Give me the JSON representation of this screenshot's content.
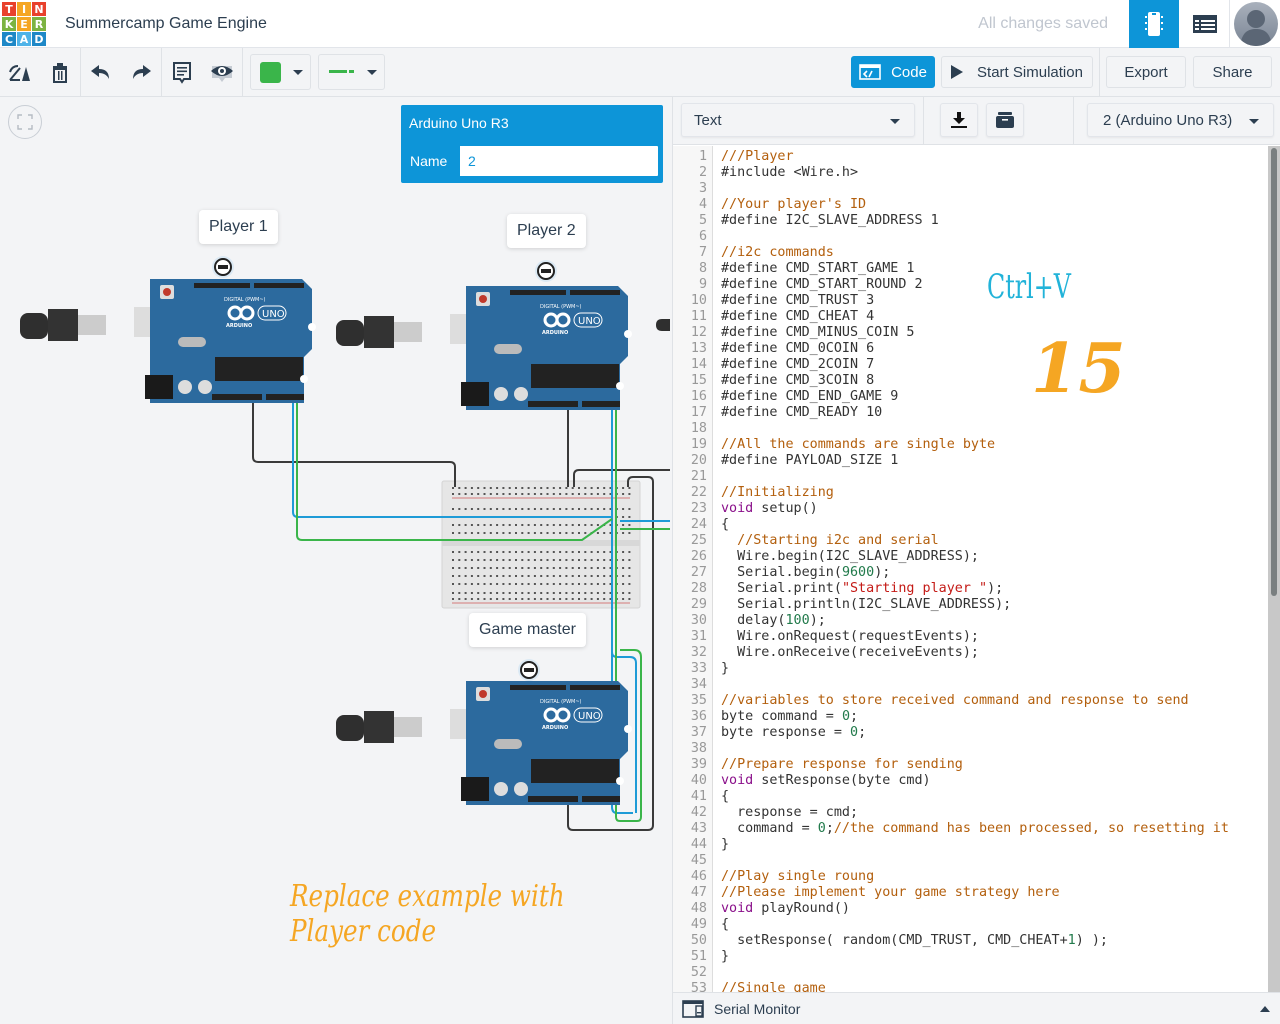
{
  "app": {
    "logo_letters": [
      "T",
      "I",
      "N",
      "K",
      "E",
      "R",
      "C",
      "A",
      "D"
    ],
    "logo_colors": [
      "#e8412c",
      "#f5a623",
      "#e8412c",
      "#7cb342",
      "#f5a623",
      "#7cb342",
      "#1e88c7",
      "#4fb3e8",
      "#1e88c7"
    ],
    "project_title": "Summercamp Game Engine",
    "save_status": "All changes saved"
  },
  "header": {
    "circuit_view_icon": "circuit-board-icon",
    "component_list_icon": "component-list-icon",
    "avatar": "user-avatar"
  },
  "toolbar": {
    "rotate_icon": "rotate-icon",
    "delete_icon": "trash-icon",
    "undo_icon": "undo-icon",
    "redo_icon": "redo-icon",
    "notes_icon": "notes-icon",
    "visibility_icon": "eye-icon",
    "color_value": "#3ab54a",
    "wire_type": "straight-wire",
    "code_label": "Code",
    "start_sim_label": "Start Simulation",
    "export_label": "Export",
    "share_label": "Share"
  },
  "canvas": {
    "fit_icon": "fit-to-view-icon",
    "inspector": {
      "title": "Arduino Uno R3",
      "name_label": "Name",
      "name_value": "2"
    },
    "labels": {
      "player1": "Player 1",
      "player2": "Player 2",
      "gamemaster": "Game master"
    },
    "annotation": "Replace example with Player code",
    "board_text": {
      "logo": "ARDUINO",
      "model": "UNO"
    }
  },
  "code_editor": {
    "mode": "Text",
    "download_icon": "download-icon",
    "library_icon": "library-icon",
    "target": "2 (Arduino Uno R3)",
    "annotation_paste": "Ctrl+V",
    "annotation_step": "15",
    "serial_monitor_label": "Serial Monitor",
    "lines": [
      [
        [
          "c",
          "///Player"
        ]
      ],
      [
        [
          "p",
          "#include <Wire.h>"
        ]
      ],
      [],
      [
        [
          "c",
          "//Your player's ID"
        ]
      ],
      [
        [
          "p",
          "#define I2C_SLAVE_ADDRESS 1"
        ]
      ],
      [],
      [
        [
          "c",
          "//i2c commands"
        ]
      ],
      [
        [
          "p",
          "#define CMD_START_GAME 1"
        ]
      ],
      [
        [
          "p",
          "#define CMD_START_ROUND 2"
        ]
      ],
      [
        [
          "p",
          "#define CMD_TRUST 3"
        ]
      ],
      [
        [
          "p",
          "#define CMD_CHEAT 4"
        ]
      ],
      [
        [
          "p",
          "#define CMD_MINUS_COIN 5"
        ]
      ],
      [
        [
          "p",
          "#define CMD_0COIN 6"
        ]
      ],
      [
        [
          "p",
          "#define CMD_2COIN 7"
        ]
      ],
      [
        [
          "p",
          "#define CMD_3COIN 8"
        ]
      ],
      [
        [
          "p",
          "#define CMD_END_GAME 9"
        ]
      ],
      [
        [
          "p",
          "#define CMD_READY 10"
        ]
      ],
      [],
      [
        [
          "c",
          "//All the commands are single byte"
        ]
      ],
      [
        [
          "p",
          "#define PAYLOAD_SIZE 1"
        ]
      ],
      [],
      [
        [
          "c",
          "//Initializing"
        ]
      ],
      [
        [
          "k",
          "void"
        ],
        [
          "p",
          " setup()"
        ]
      ],
      [
        [
          "p",
          "{"
        ]
      ],
      [
        [
          "c",
          "  //Starting i2c and serial"
        ]
      ],
      [
        [
          "p",
          "  Wire.begin(I2C_SLAVE_ADDRESS);"
        ]
      ],
      [
        [
          "p",
          "  Serial.begin("
        ],
        [
          "n",
          "9600"
        ],
        [
          "p",
          ");"
        ]
      ],
      [
        [
          "p",
          "  Serial.print("
        ],
        [
          "s",
          "\"Starting player \""
        ],
        [
          "p",
          ");"
        ]
      ],
      [
        [
          "p",
          "  Serial.println(I2C_SLAVE_ADDRESS);"
        ]
      ],
      [
        [
          "p",
          "  delay("
        ],
        [
          "n",
          "100"
        ],
        [
          "p",
          ");"
        ]
      ],
      [
        [
          "p",
          "  Wire.onRequest(requestEvents);"
        ]
      ],
      [
        [
          "p",
          "  Wire.onReceive(receiveEvents);"
        ]
      ],
      [
        [
          "p",
          "}"
        ]
      ],
      [],
      [
        [
          "c",
          "//variables to store received command and response to send"
        ]
      ],
      [
        [
          "p",
          "byte command = "
        ],
        [
          "n",
          "0"
        ],
        [
          "p",
          ";"
        ]
      ],
      [
        [
          "p",
          "byte response = "
        ],
        [
          "n",
          "0"
        ],
        [
          "p",
          ";"
        ]
      ],
      [],
      [
        [
          "c",
          "//Prepare response for sending"
        ]
      ],
      [
        [
          "k",
          "void"
        ],
        [
          "p",
          " setResponse(byte cmd)"
        ]
      ],
      [
        [
          "p",
          "{"
        ]
      ],
      [
        [
          "p",
          "  response = cmd;"
        ]
      ],
      [
        [
          "p",
          "  command = "
        ],
        [
          "n",
          "0"
        ],
        [
          "p",
          ";"
        ],
        [
          "c",
          "//the command has been processed, so resetting it"
        ]
      ],
      [
        [
          "p",
          "}"
        ]
      ],
      [],
      [
        [
          "c",
          "//Play single roung"
        ]
      ],
      [
        [
          "c",
          "//Please implement your game strategy here"
        ]
      ],
      [
        [
          "k",
          "void"
        ],
        [
          "p",
          " playRound()"
        ]
      ],
      [
        [
          "p",
          "{"
        ]
      ],
      [
        [
          "p",
          "  setResponse( random(CMD_TRUST, CMD_CHEAT+"
        ],
        [
          "n",
          "1"
        ],
        [
          "p",
          ") );"
        ]
      ],
      [
        [
          "p",
          "}"
        ]
      ],
      [],
      [
        [
          "c",
          "//Single game"
        ]
      ]
    ]
  },
  "colors": {
    "accent": "#0d95d8",
    "annotation_orange": "#f5a623",
    "annotation_cyan": "#22b3d9",
    "board_blue": "#2c6a9e",
    "wire_black": "#3a3a3a",
    "wire_blue": "#1e9bd7",
    "wire_green": "#3ab54a"
  }
}
